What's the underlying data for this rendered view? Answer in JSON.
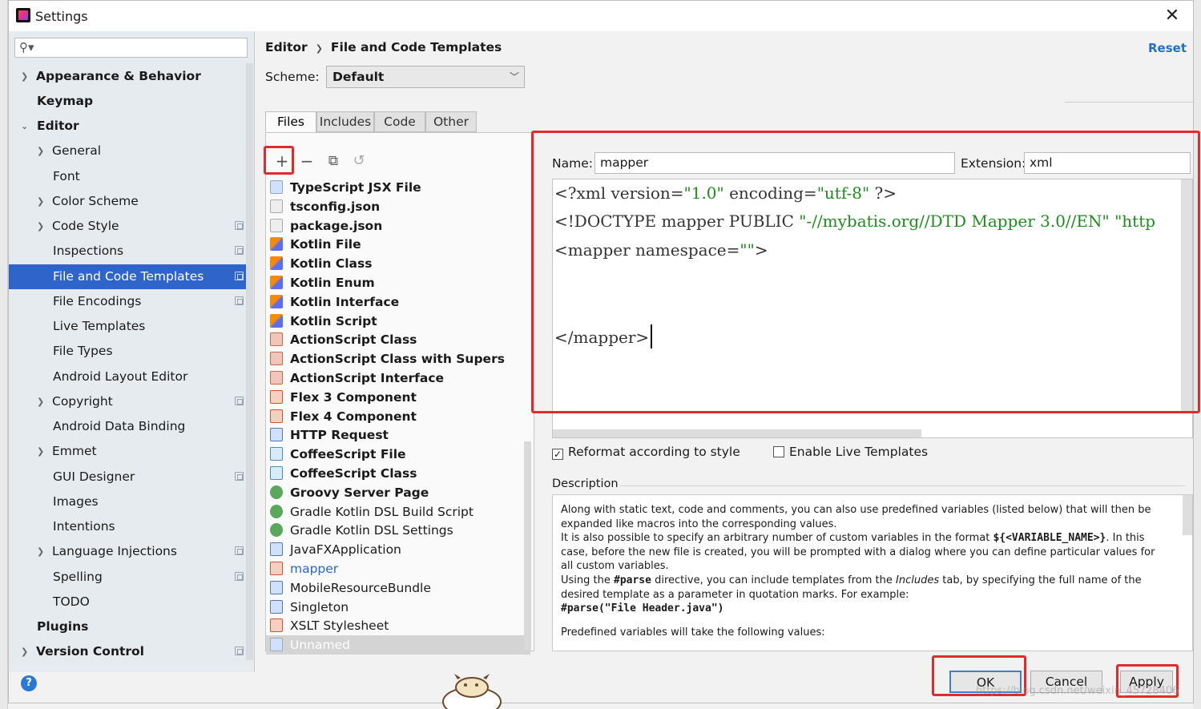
{
  "window": {
    "title": "Settings"
  },
  "sidebar": {
    "search_placeholder": "",
    "items": [
      {
        "label": "Appearance & Behavior"
      },
      {
        "label": "Keymap"
      },
      {
        "label": "Editor"
      },
      {
        "label": "General"
      },
      {
        "label": "Font"
      },
      {
        "label": "Color Scheme"
      },
      {
        "label": "Code Style"
      },
      {
        "label": "Inspections"
      },
      {
        "label": "File and Code Templates"
      },
      {
        "label": "File Encodings"
      },
      {
        "label": "Live Templates"
      },
      {
        "label": "File Types"
      },
      {
        "label": "Android Layout Editor"
      },
      {
        "label": "Copyright"
      },
      {
        "label": "Android Data Binding"
      },
      {
        "label": "Emmet"
      },
      {
        "label": "GUI Designer"
      },
      {
        "label": "Images"
      },
      {
        "label": "Intentions"
      },
      {
        "label": "Language Injections"
      },
      {
        "label": "Spelling"
      },
      {
        "label": "TODO"
      },
      {
        "label": "Plugins"
      },
      {
        "label": "Version Control"
      }
    ]
  },
  "header": {
    "breadcrumb_1": "Editor",
    "breadcrumb_2": "File and Code Templates",
    "reset": "Reset",
    "scheme_label": "Scheme:",
    "scheme_value": "Default"
  },
  "tabs": [
    {
      "label": "Files"
    },
    {
      "label": "Includes"
    },
    {
      "label": "Code"
    },
    {
      "label": "Other"
    }
  ],
  "templates": [
    {
      "label": "TypeScript JSX File"
    },
    {
      "label": "tsconfig.json"
    },
    {
      "label": "package.json"
    },
    {
      "label": "Kotlin File"
    },
    {
      "label": "Kotlin Class"
    },
    {
      "label": "Kotlin Enum"
    },
    {
      "label": "Kotlin Interface"
    },
    {
      "label": "Kotlin Script"
    },
    {
      "label": "ActionScript Class"
    },
    {
      "label": "ActionScript Class with Supers"
    },
    {
      "label": "ActionScript Interface"
    },
    {
      "label": "Flex 3 Component"
    },
    {
      "label": "Flex 4 Component"
    },
    {
      "label": "HTTP Request"
    },
    {
      "label": "CoffeeScript File"
    },
    {
      "label": "CoffeeScript Class"
    },
    {
      "label": "Groovy Server Page"
    },
    {
      "label": "Gradle Kotlin DSL Build Script"
    },
    {
      "label": "Gradle Kotlin DSL Settings"
    },
    {
      "label": "JavaFXApplication"
    },
    {
      "label": "mapper"
    },
    {
      "label": "MobileResourceBundle"
    },
    {
      "label": "Singleton"
    },
    {
      "label": "XSLT Stylesheet"
    },
    {
      "label": "Unnamed"
    }
  ],
  "editor": {
    "name_label": "Name:",
    "name_value": "mapper",
    "ext_label": "Extension:",
    "ext_value": "xml",
    "line1_a": "<?xml version=",
    "line1_b": "\"1.0\"",
    "line1_c": " encoding=",
    "line1_d": "\"utf-8\"",
    "line1_e": " ?>",
    "line2_a": "<!DOCTYPE mapper PUBLIC ",
    "line2_b": "\"-//mybatis.org//DTD Mapper 3.0//EN\"",
    "line2_c": " \"http",
    "line3_a": "<mapper namespace=",
    "line3_b": "\"\"",
    "line3_c": ">",
    "line4": "</mapper>"
  },
  "options": {
    "reformat": "Reformat according to style",
    "reformat_checked": true,
    "live": "Enable Live Templates",
    "live_checked": false
  },
  "description": {
    "label": "Description",
    "p1": "Along with static text, code and comments, you can also use predefined variables (listed below) that will then be expanded like macros into the corresponding values.",
    "p2a": "It is also possible to specify an arbitrary number of custom variables in the format ",
    "p2b": "${<VARIABLE_NAME>}",
    "p2c": ". In this case, before the new file is created, you will be prompted with a dialog where you can define particular values for all custom variables.",
    "p3a": "Using the ",
    "p3b": "#parse",
    "p3c": " directive, you can include templates from the ",
    "p3d": "Includes",
    "p3e": " tab, by specifying the full name of the desired template as a parameter in quotation marks. For example:",
    "p4": "#parse(\"File Header.java\")",
    "p5": "Predefined variables will take the following values:"
  },
  "buttons": {
    "ok": "OK",
    "cancel": "Cancel",
    "apply": "Apply"
  },
  "watermark": "https://blog.csdn.net/weixin_45728406",
  "colors": {
    "accent": "#2f65ca",
    "highlight_box": "#e32a2a",
    "string": "#1e8c1e",
    "link": "#2470c7"
  }
}
